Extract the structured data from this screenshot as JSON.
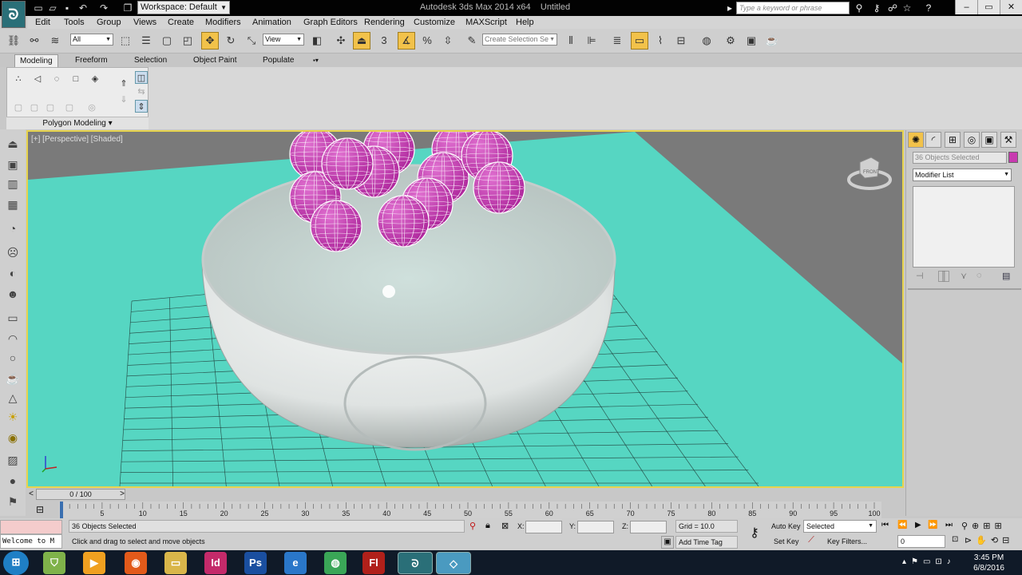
{
  "app": {
    "title": "Autodesk 3ds Max  2014 x64",
    "document": "Untitled",
    "workspace": "Workspace: Default",
    "search_placeholder": "Type a keyword or phrase"
  },
  "menu": [
    "Edit",
    "Tools",
    "Group",
    "Views",
    "Create",
    "Modifiers",
    "Animation",
    "Graph Editors",
    "Rendering",
    "Customize",
    "MAXScript",
    "Help"
  ],
  "toolbar": {
    "selection_filter": "All",
    "reference_coord": "View",
    "named_selection_placeholder": "Create Selection Se",
    "angle_snap_label": "3"
  },
  "ribbon": {
    "tabs": [
      "Modeling",
      "Freeform",
      "Selection",
      "Object Paint",
      "Populate"
    ],
    "panel_label": "Polygon Modeling"
  },
  "viewport": {
    "label": "[+] [Perspective] [Shaded]",
    "viewcube_label": "FRONT",
    "bg_color": "#7a7a7a",
    "ground_color": "#56d6c2",
    "grid_color": "#1f3b37",
    "sphere_color": "#b02a9e",
    "bowl_color": "#dfe3e2"
  },
  "command_panel": {
    "selected": "36 Objects Selected",
    "modifier_list": "Modifier List",
    "swatch_color": "#c83ab0"
  },
  "timeline": {
    "slider": "0 / 100",
    "ticks": [
      "0",
      "5",
      "10",
      "15",
      "20",
      "25",
      "30",
      "35",
      "40",
      "45",
      "50",
      "55",
      "60",
      "65",
      "70",
      "75",
      "80",
      "85",
      "90",
      "95",
      "100"
    ]
  },
  "status": {
    "maxscript": "Welcome to M",
    "objects_selected": "36 Objects Selected",
    "prompt": "Click and drag to select and move objects",
    "x_label": "X:",
    "y_label": "Y:",
    "z_label": "Z:",
    "grid": "Grid = 10.0",
    "auto_key": "Auto Key",
    "set_key": "Set Key",
    "selected_dropdown": "Selected",
    "key_filters": "Key Filters...",
    "add_time_tag": "Add Time Tag",
    "frame": "0"
  },
  "taskbar": {
    "time": "3:45 PM",
    "date": "6/8/2016",
    "apps": [
      "Firefox",
      "Media Player",
      "Explorer",
      "Id",
      "Ps",
      "IE",
      "Chrome",
      "Fl",
      "3ds Max",
      "Editor"
    ]
  }
}
